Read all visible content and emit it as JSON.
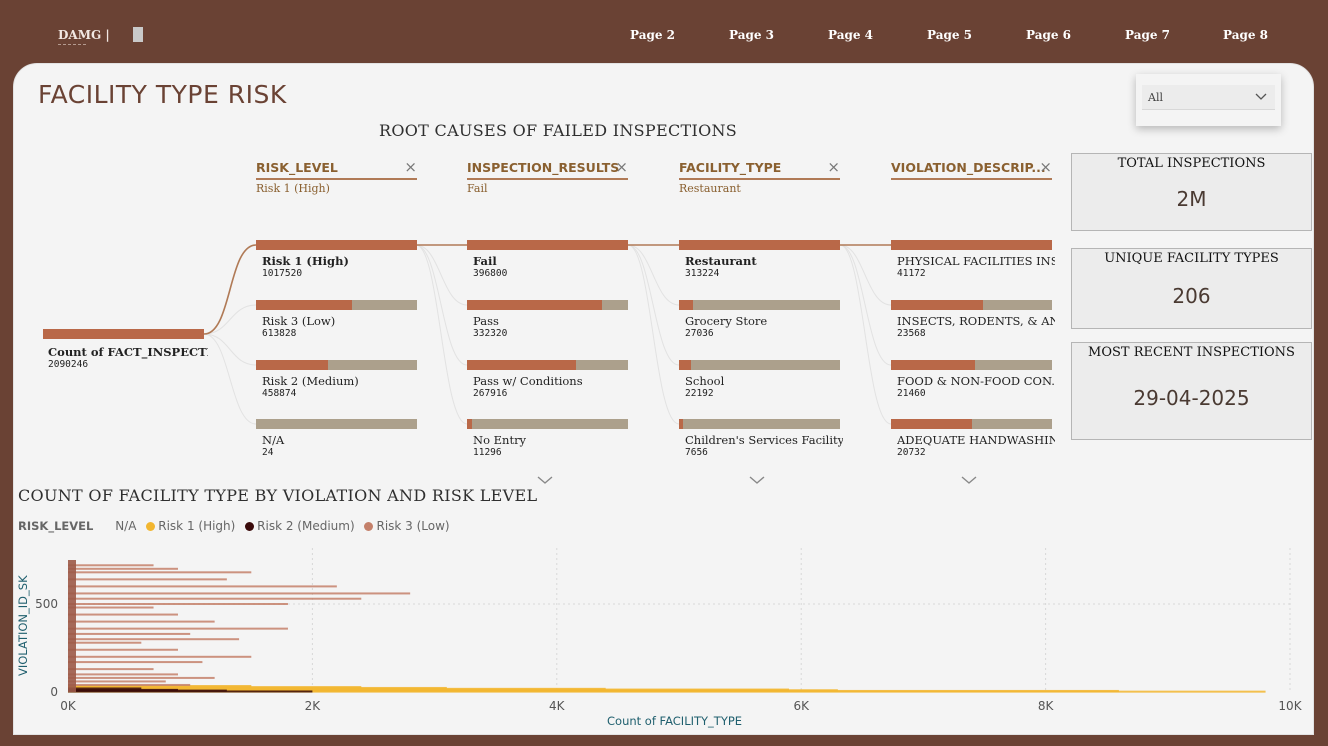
{
  "nav": {
    "brand": "DAMG |",
    "pages": [
      "Page 2",
      "Page 3",
      "Page 4",
      "Page 5",
      "Page 6",
      "Page 7",
      "Page 8"
    ]
  },
  "page_title": "FACILITY TYPE RISK",
  "slicer": {
    "value": "All",
    "icon": "chevron-down-icon"
  },
  "decomp": {
    "title": "ROOT CAUSES OF FAILED INSPECTIONS",
    "root": {
      "label": "Count of FACT_INSPECTI...",
      "value": "2090246"
    },
    "levels": [
      {
        "name": "RISK_LEVEL",
        "selected": "Risk 1 (High)",
        "nodes": [
          {
            "label": "Risk 1 (High)",
            "value": "1017520",
            "fill": 1.0,
            "selected": true
          },
          {
            "label": "Risk 3 (Low)",
            "value": "613828",
            "fill": 0.6
          },
          {
            "label": "Risk 2 (Medium)",
            "value": "458874",
            "fill": 0.45
          },
          {
            "label": "N/A",
            "value": "24",
            "fill": 0.0
          }
        ]
      },
      {
        "name": "INSPECTION_RESULTS",
        "selected": "Fail",
        "nodes": [
          {
            "label": "Fail",
            "value": "396800",
            "fill": 1.0,
            "selected": true
          },
          {
            "label": "Pass",
            "value": "332320",
            "fill": 0.84
          },
          {
            "label": "Pass w/ Conditions",
            "value": "267916",
            "fill": 0.68
          },
          {
            "label": "No Entry",
            "value": "11296",
            "fill": 0.03
          }
        ]
      },
      {
        "name": "FACILITY_TYPE",
        "selected": "Restaurant",
        "nodes": [
          {
            "label": "Restaurant",
            "value": "313224",
            "fill": 1.0,
            "selected": true
          },
          {
            "label": "Grocery Store",
            "value": "27036",
            "fill": 0.086
          },
          {
            "label": "School",
            "value": "22192",
            "fill": 0.071
          },
          {
            "label": "Children's Services Facility",
            "value": "7656",
            "fill": 0.025
          }
        ]
      },
      {
        "name": "VIOLATION_DESCRIP...",
        "selected": "",
        "nodes": [
          {
            "label": "PHYSICAL FACILITIES INSTA...",
            "value": "41172",
            "fill": 1.0
          },
          {
            "label": "INSECTS, RODENTS, & ANI...",
            "value": "23568",
            "fill": 0.57
          },
          {
            "label": "FOOD & NON-FOOD CON...",
            "value": "21460",
            "fill": 0.52
          },
          {
            "label": "ADEQUATE HANDWASHIN...",
            "value": "20732",
            "fill": 0.5
          }
        ]
      }
    ]
  },
  "cards": [
    {
      "title": "TOTAL INSPECTIONS",
      "value": "2M"
    },
    {
      "title": "UNIQUE FACILITY TYPES",
      "value": "206"
    },
    {
      "title": "MOST RECENT INSPECTIONS",
      "value": "29-04-2025"
    }
  ],
  "legend": {
    "title": "RISK_LEVEL",
    "items": [
      {
        "label": "N/A",
        "color": ""
      },
      {
        "label": "Risk 1 (High)",
        "color": "#f2b630"
      },
      {
        "label": "Risk 2 (Medium)",
        "color": "#3a0a0a"
      },
      {
        "label": "Risk 3 (Low)",
        "color": "#c4806a"
      }
    ]
  },
  "chart_data": {
    "type": "bar",
    "orientation": "horizontal",
    "title": "COUNT OF FACILITY TYPE BY VIOLATION AND RISK LEVEL",
    "xlabel": "Count of FACILITY_TYPE",
    "ylabel": "VIOLATION_ID_SK",
    "x_ticks": [
      "0K",
      "2K",
      "4K",
      "6K",
      "8K",
      "10K"
    ],
    "y_ticks": [
      "0",
      "500"
    ],
    "xlim": [
      0,
      10000
    ],
    "ylim": [
      0,
      750
    ],
    "grid": true,
    "series": [
      {
        "name": "Risk 1 (High)",
        "color": "#f2b630",
        "points": [
          [
            2,
            9800
          ],
          [
            6,
            8600
          ],
          [
            10,
            6300
          ],
          [
            14,
            5900
          ],
          [
            18,
            4400
          ],
          [
            23,
            3100
          ],
          [
            28,
            2400
          ],
          [
            34,
            1500
          ]
        ]
      },
      {
        "name": "Risk 2 (Medium)",
        "color": "#3a0a0a",
        "points": [
          [
            3,
            2000
          ],
          [
            8,
            1300
          ],
          [
            12,
            900
          ],
          [
            20,
            600
          ]
        ]
      },
      {
        "name": "Risk 3 (Low)",
        "color": "#c4806a",
        "points": [
          [
            40,
            1000
          ],
          [
            60,
            800
          ],
          [
            80,
            1200
          ],
          [
            100,
            900
          ],
          [
            130,
            700
          ],
          [
            170,
            1100
          ],
          [
            200,
            1500
          ],
          [
            240,
            900
          ],
          [
            280,
            600
          ],
          [
            300,
            1400
          ],
          [
            330,
            1000
          ],
          [
            360,
            1800
          ],
          [
            400,
            1200
          ],
          [
            440,
            900
          ],
          [
            480,
            700
          ],
          [
            500,
            1800
          ],
          [
            530,
            2400
          ],
          [
            560,
            2800
          ],
          [
            600,
            2200
          ],
          [
            640,
            1300
          ],
          [
            680,
            1500
          ],
          [
            700,
            900
          ],
          [
            720,
            700
          ]
        ]
      }
    ]
  }
}
